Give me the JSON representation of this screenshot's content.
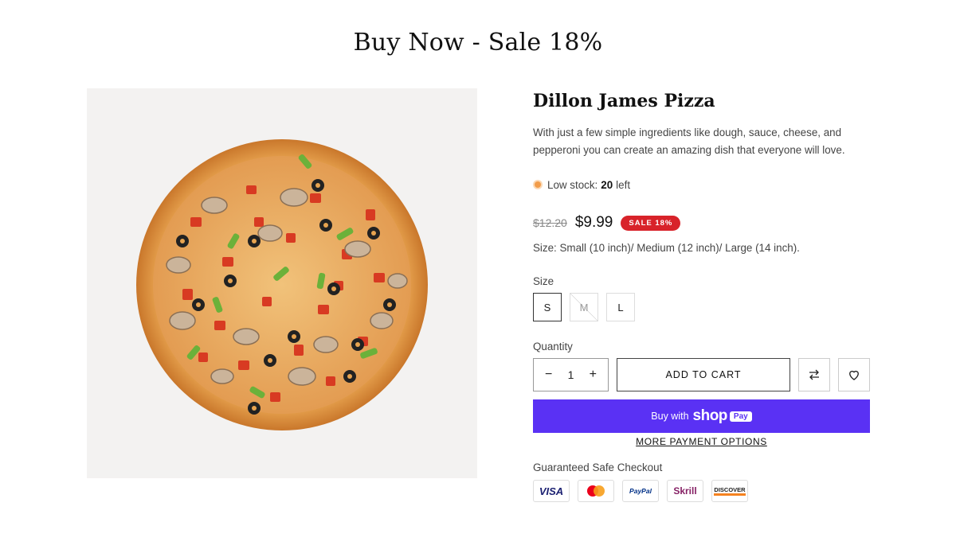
{
  "page": {
    "title": "Buy Now - Sale 18%"
  },
  "product": {
    "name": "Dillon James Pizza",
    "description": "With just a few simple ingredients like dough, sauce, cheese, and pepperoni you can create an amazing dish that everyone will love.",
    "stock": {
      "prefix": "Low stock:",
      "count": "20",
      "suffix": "left",
      "dot_color": "#f29c4a"
    },
    "price": {
      "original": "$12.20",
      "sale": "$9.99",
      "badge": "SALE 18%",
      "badge_color": "#d8232a"
    },
    "size_note": "Size: Small (10 inch)/ Medium (12 inch)/ Large (14 inch)."
  },
  "size": {
    "label": "Size",
    "options": [
      {
        "label": "S",
        "selected": true,
        "available": true
      },
      {
        "label": "M",
        "selected": false,
        "available": false
      },
      {
        "label": "L",
        "selected": false,
        "available": true
      }
    ]
  },
  "quantity": {
    "label": "Quantity",
    "value": "1",
    "minus": "−",
    "plus": "+"
  },
  "actions": {
    "add_to_cart": "ADD TO CART",
    "compare_icon": "compare-arrows-icon",
    "wishlist_icon": "heart-icon",
    "shop_pay": {
      "buy_with": "Buy with",
      "shop": "shop",
      "pay": "Pay",
      "color": "#5a31f4"
    },
    "more_payment": "MORE PAYMENT OPTIONS"
  },
  "checkout": {
    "label": "Guaranteed Safe Checkout",
    "methods": [
      "VISA",
      "Mastercard",
      "PayPal",
      "Skrill",
      "DISCOVER"
    ]
  }
}
